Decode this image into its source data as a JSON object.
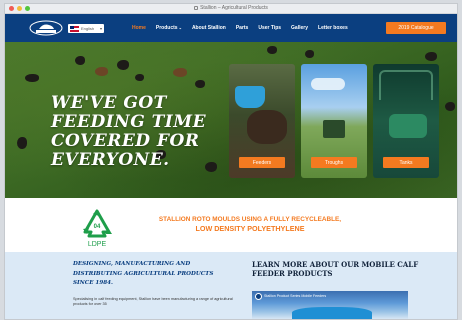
{
  "window": {
    "title": "Stallion – Agricultural Products"
  },
  "nav": {
    "logo_text": "STALLION",
    "language": "English",
    "menu": [
      {
        "label": "Home",
        "active": true
      },
      {
        "label": "Products",
        "dropdown": true
      },
      {
        "label": "About Stallion"
      },
      {
        "label": "Parts"
      },
      {
        "label": "User Tips"
      },
      {
        "label": "Gallery"
      },
      {
        "label": "Letter boxes"
      }
    ],
    "cta": "2019 Catalogue"
  },
  "hero": {
    "headline": "WE'VE GOT FEEDING TIME COVERED FOR EVERYONE.",
    "cards": [
      {
        "label": "Feeders"
      },
      {
        "label": "Troughs"
      },
      {
        "label": "Tanks"
      }
    ]
  },
  "recycle": {
    "code": "04",
    "material": "LDPE",
    "line1": "STALLION ROTO MOULDS USING A FULLY RECYCLEABLE,",
    "line2": "LOW DENSITY POLYETHYLENE"
  },
  "about": {
    "heading": "DESIGNING, MANUFACTURING AND DISTRIBUTING AGRICULTURAL PRODUCTS SINCE 1984.",
    "body": "Specialising in calf feeding equipment, Stallion have been manufacturing a range of agricultural products for over 35"
  },
  "video_section": {
    "heading": "LEARN MORE ABOUT OUR MOBILE CALF FEEDER PRODUCTS",
    "video_title": "Stallion Product Series Mobile Feeders"
  },
  "colors": {
    "nav_bg": "#0b3f80",
    "accent": "#f47a20",
    "recycle_green": "#1e9e4a",
    "lower_bg": "#dbe9f6"
  }
}
